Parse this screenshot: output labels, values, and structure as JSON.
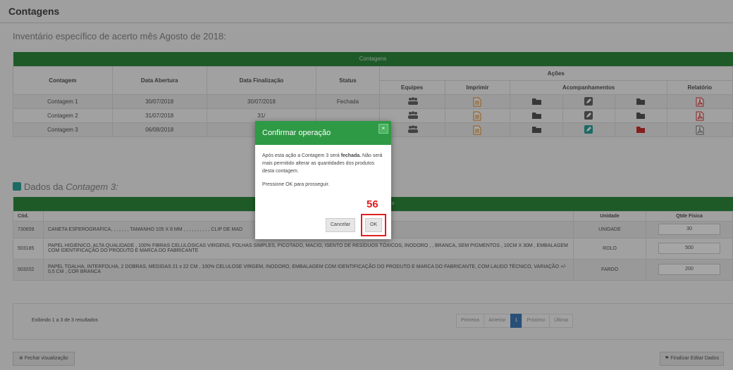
{
  "page_title": "Contagens",
  "subtitle": "Inventário específico de acerto mês Agosto de 2018:",
  "table1": {
    "group_header": "Contagens",
    "acoes_header": "Ações",
    "columns": [
      "Contagem",
      "Data Abertura",
      "Data Finalização",
      "Status",
      "Equipes",
      "Imprimir",
      "Acompanhamentos",
      "Relatório"
    ],
    "rows": [
      {
        "contagem": "Contagem 1",
        "abertura": "30/07/2018",
        "finalizacao": "30/07/2018",
        "status": "Fechada"
      },
      {
        "contagem": "Contagem 2",
        "abertura": "31/07/2018",
        "finalizacao": "31/",
        "status": ""
      },
      {
        "contagem": "Contagem 3",
        "abertura": "06/08/2018",
        "finalizacao": "",
        "status": ""
      }
    ]
  },
  "dados": {
    "prefix": "Dados da",
    "italic": "Contagem 3:"
  },
  "table2": {
    "group_header": "s 3 deste inventário",
    "cols": {
      "cod": "Cód.",
      "unidade": "Unidade",
      "qtde": "Qtde Física"
    },
    "rows": [
      {
        "cod": "730659",
        "desc": "CANETA ESFEROGRAFICA, , , , , , , TAMANHO 105 X 8 MM , , , , , , , , , , CLIP DE MAD",
        "unidade": "UNIDADE",
        "qtde": "30"
      },
      {
        "cod": "503185",
        "desc": "PAPEL HIGIENICO, ALTA QUALIDADE , 100% FIBRAS CELULÓSICAS VIRGENS, FOLHAS SIMPLES, PICOTADO, MACIO, ISENTO DE RESÍDUOS TÓXICOS, INODORO , , BRANCA, SEM PIGMENTOS , 10CM X 30M , EMBALAGEM COM IDENTIFICAÇÃO DO PRODUTO E MARCA DO FABRICANTE",
        "unidade": "ROLO",
        "qtde": "500"
      },
      {
        "cod": "503202",
        "desc": "PAPEL TOALHA, INTERFOLHA, 2 DOBRAS, MEDIDAS 21 x 22 CM , 100% CELULOSE VIRGEM, INODORO, EMBALAGEM COM IDENTIFICAÇÃO DO PRODUTO E MARCA DO FABRICANTE, COM LAUDO TÉCNICO, VARIAÇÃO +/- 0,5 CM , COR BRANCA",
        "unidade": "FARDO",
        "qtde": "200"
      }
    ]
  },
  "results_text": "Exibindo 1 a 3 de 3 resultados",
  "pagination": {
    "first": "Primeira",
    "prev": "Anterior",
    "current": "1",
    "next": "Próximo",
    "last": "Última"
  },
  "btn_close": "Fechar visualização",
  "btn_final": "Finalizar Editar Dados",
  "modal": {
    "title": "Confirmar operação",
    "close": "×",
    "body_pre": "Após esta ação a Contagem 3 será ",
    "body_bold": "fechada.",
    "body_post": " Não será mais permitido alterar as quantidades dos produtos desta contagem.",
    "body2": "Pressione OK para prosseguir.",
    "cancel": "Cancelar",
    "ok": "OK"
  },
  "step_number": "56"
}
